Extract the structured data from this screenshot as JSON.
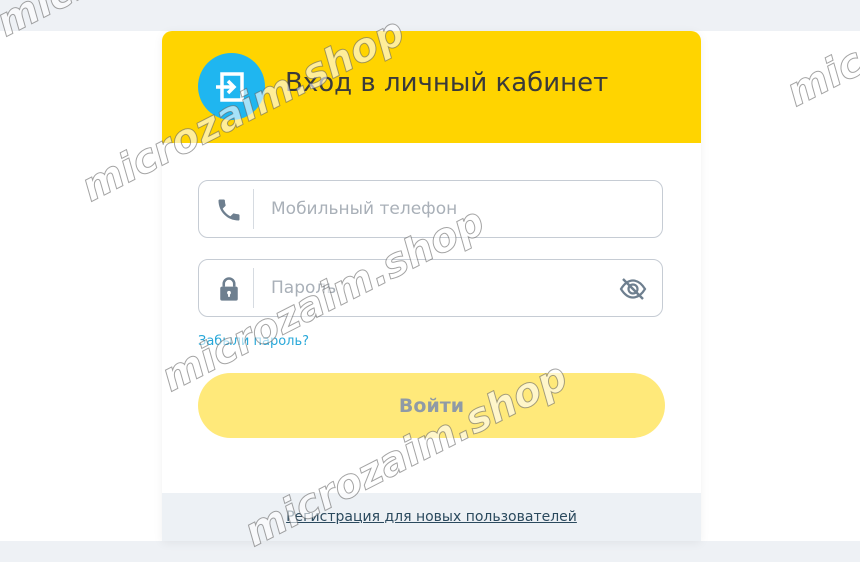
{
  "login": {
    "title": "Вход в личный кабинет",
    "phone_placeholder": "Мобильный телефон",
    "password_placeholder": "Пароль",
    "forgot_password": "Забыли пароль?",
    "submit_label": "Войти",
    "register_link": "Регистрация для новых пользователей"
  },
  "watermark": "microzaim.shop",
  "colors": {
    "header_bg": "#ffd400",
    "icon_circle": "#1fb6f0",
    "button_bg": "#ffe97a",
    "button_text": "#8f9aa6",
    "link": "#29a8d9",
    "footer_bg": "#edf1f5"
  },
  "icons": {
    "header": "login-exit-icon",
    "phone": "phone-icon",
    "password": "lock-icon",
    "visibility": "eye-crossed-icon"
  }
}
